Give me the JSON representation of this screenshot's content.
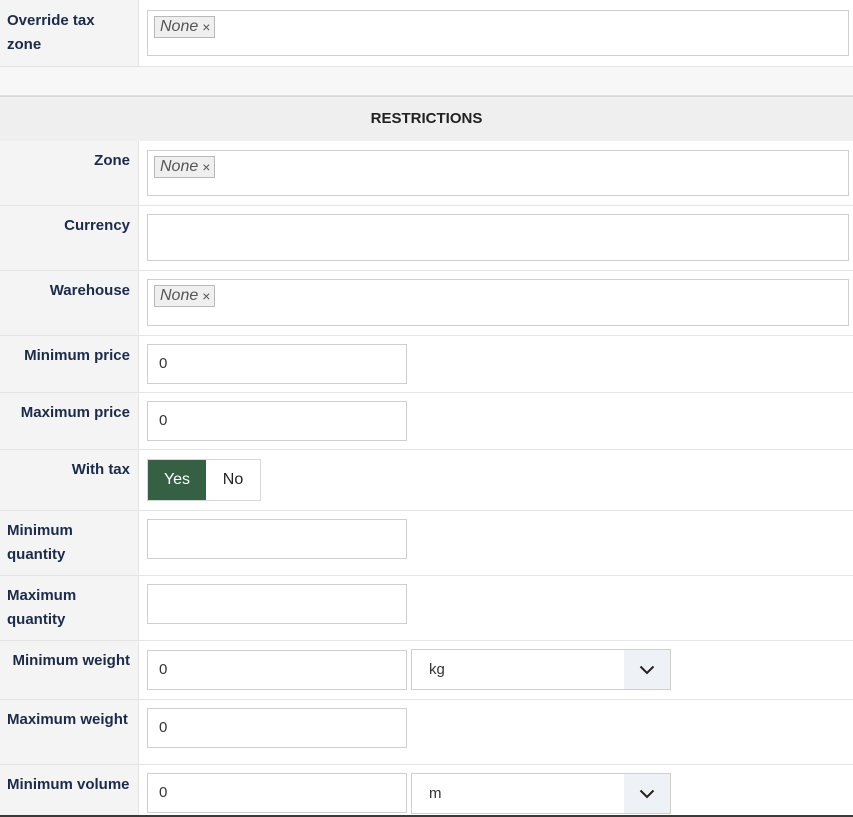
{
  "tax": {
    "override_label": "Override tax zone",
    "override_tag": "None"
  },
  "section": {
    "title": "RESTRICTIONS"
  },
  "restrictions": {
    "zone": {
      "label": "Zone",
      "tag": "None"
    },
    "currency": {
      "label": "Currency"
    },
    "warehouse": {
      "label": "Warehouse",
      "tag": "None"
    },
    "min_price": {
      "label": "Minimum price",
      "value": "0"
    },
    "max_price": {
      "label": "Maximum price",
      "value": "0"
    },
    "with_tax": {
      "label": "With tax",
      "yes": "Yes",
      "no": "No",
      "selected": "Yes"
    },
    "min_qty": {
      "label": "Minimum quantity",
      "value": ""
    },
    "max_qty": {
      "label": "Maximum quantity",
      "value": ""
    },
    "min_weight": {
      "label": "Minimum weight",
      "value": "0",
      "unit": "kg"
    },
    "max_weight": {
      "label": "Maximum weight",
      "value": "0"
    },
    "min_volume": {
      "label": "Minimum volume",
      "value": "0",
      "unit": "m"
    }
  },
  "tag_remove_glyph": "×",
  "colors": {
    "toggle_active": "#356043",
    "label_text": "#1c2b4a"
  }
}
